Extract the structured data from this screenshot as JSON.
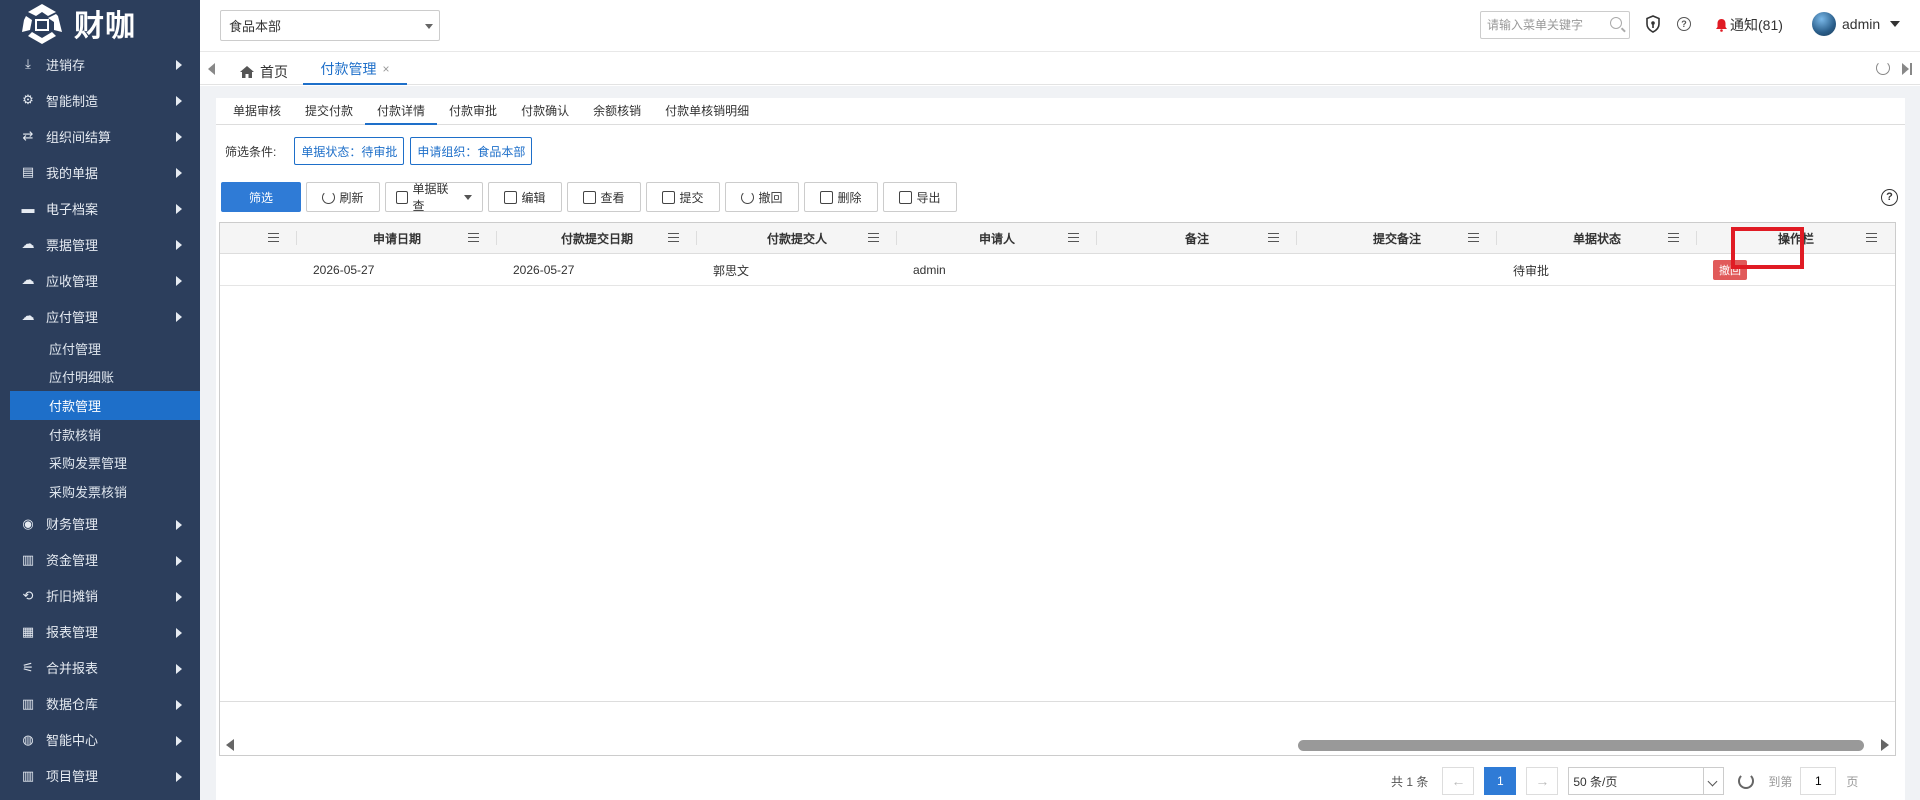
{
  "app": {
    "logo_text": "财咖",
    "colors": {
      "sidebar_bg": "#2c3e5c",
      "primary": "#1e6fc9",
      "danger": "#e15a5a",
      "highlight": "#e01b24"
    }
  },
  "sidebar": {
    "items": [
      {
        "label": "进销存",
        "icon": "download-icon"
      },
      {
        "label": "智能制造",
        "icon": "gears-icon"
      },
      {
        "label": "组织间结算",
        "icon": "exchange-icon"
      },
      {
        "label": "我的单据",
        "icon": "document-icon"
      },
      {
        "label": "电子档案",
        "icon": "archive-icon"
      },
      {
        "label": "票据管理",
        "icon": "cloud-upload-icon"
      },
      {
        "label": "应收管理",
        "icon": "cloud-upload-icon"
      },
      {
        "label": "应付管理",
        "icon": "cloud-upload-icon"
      }
    ],
    "submenu": [
      {
        "label": "应付管理"
      },
      {
        "label": "应付明细账"
      },
      {
        "label": "付款管理",
        "active": true
      },
      {
        "label": "付款核销"
      },
      {
        "label": "采购发票管理"
      },
      {
        "label": "采购发票核销"
      }
    ],
    "items_after": [
      {
        "label": "财务管理",
        "icon": "circle-dot-icon"
      },
      {
        "label": "资金管理",
        "icon": "bar-chart-icon"
      },
      {
        "label": "折旧摊销",
        "icon": "repeat-icon"
      },
      {
        "label": "报表管理",
        "icon": "report-icon"
      },
      {
        "label": "合并报表",
        "icon": "merge-icon"
      },
      {
        "label": "数据仓库",
        "icon": "bar-chart-icon"
      },
      {
        "label": "智能中心",
        "icon": "globe-icon"
      },
      {
        "label": "项目管理",
        "icon": "bar-chart-icon"
      }
    ]
  },
  "topbar": {
    "org_select": "食品本部",
    "search_placeholder": "请输入菜单关键字",
    "notice": "通知(81)",
    "user": "admin"
  },
  "tabs": {
    "home": "首页",
    "active": "付款管理",
    "close": "×"
  },
  "subtabs": [
    "单据审核",
    "提交付款",
    "付款详情",
    "付款审批",
    "付款确认",
    "余额核销",
    "付款单核销明细"
  ],
  "subtab_active_index": 2,
  "filter": {
    "label": "筛选条件:",
    "chips": [
      "单据状态：待审批",
      "申请组织：食品本部"
    ]
  },
  "toolbar": {
    "filter": "筛选",
    "refresh": "刷新",
    "link_query": "单据联查",
    "edit": "编辑",
    "view": "查看",
    "submit": "提交",
    "recall": "撤回",
    "delete": "删除",
    "export": "导出"
  },
  "grid": {
    "columns": [
      "",
      "申请日期",
      "付款提交日期",
      "付款提交人",
      "申请人",
      "备注",
      "提交备注",
      "单据状态",
      "操作栏"
    ],
    "rows": [
      {
        "apply_date": "2026-05-27",
        "submit_date": "2026-05-27",
        "submitter": "郭思文",
        "applicant": "admin",
        "remark": "",
        "submit_remark": "",
        "status": "待审批",
        "action": "撤回"
      }
    ]
  },
  "pager": {
    "total": "共 1 条",
    "prev": "←",
    "current": "1",
    "next": "→",
    "page_size": "50 条/页",
    "goto_label": "到第",
    "goto_value": "1",
    "page_suffix": "页"
  }
}
